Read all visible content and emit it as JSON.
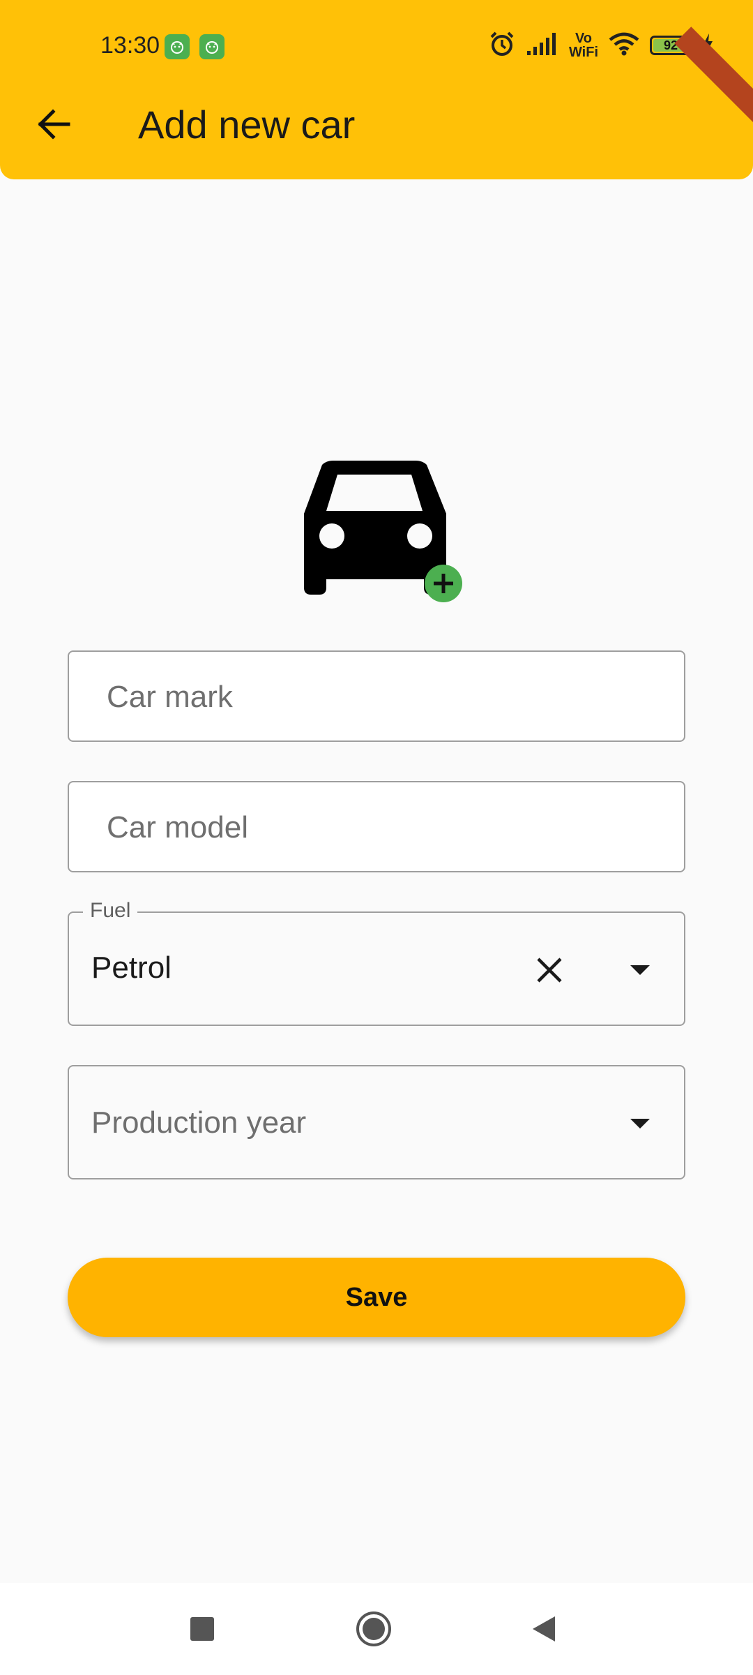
{
  "status_bar": {
    "time": "13:30",
    "network_label_top": "Vo",
    "network_label_bottom": "WiFi",
    "battery_level": "92",
    "icons": [
      "notification-app-icon",
      "notification-app-icon",
      "alarm-icon",
      "signal-icon",
      "wifi-icon",
      "battery-icon",
      "charging-icon"
    ]
  },
  "app_bar": {
    "title": "Add new car",
    "back_icon": "arrow-left-icon",
    "color": "#ffc107"
  },
  "form": {
    "car_icon": "car-add-icon",
    "car_mark_placeholder": "Car mark",
    "car_model_placeholder": "Car model",
    "fuel": {
      "label": "Fuel",
      "value": "Petrol",
      "clear_icon": "close-icon",
      "dropdown_icon": "caret-down-icon"
    },
    "production_year": {
      "placeholder": "Production year",
      "dropdown_icon": "caret-down-icon"
    },
    "save_label": "Save",
    "accent": "#ffb300",
    "add_badge_color": "#4caf50"
  },
  "nav_bar": {
    "icons": [
      "square-recents-icon",
      "circle-home-icon",
      "triangle-back-icon"
    ]
  }
}
